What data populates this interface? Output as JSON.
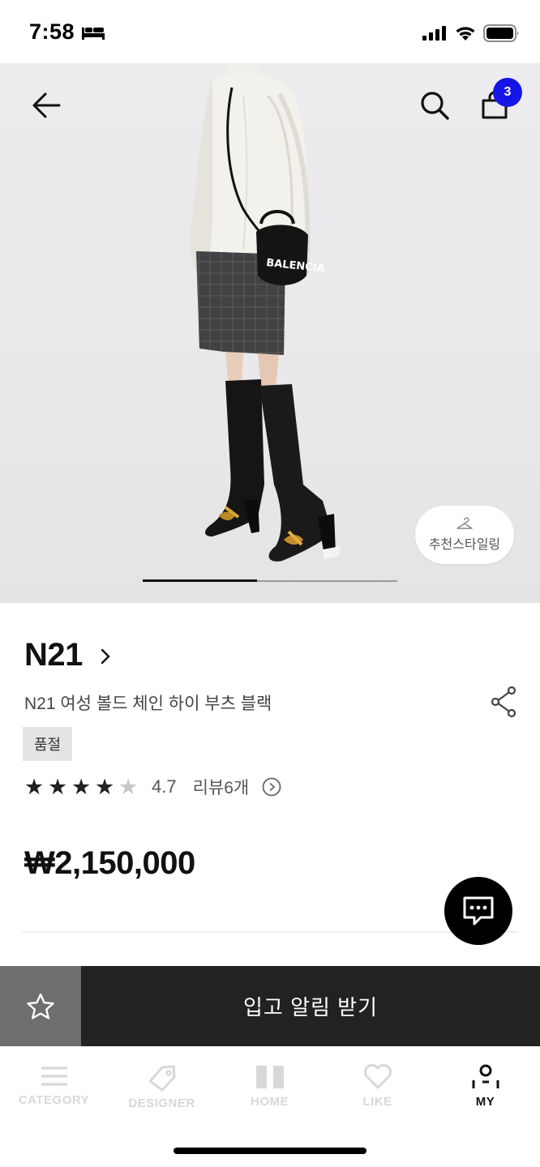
{
  "status_bar": {
    "time": "7:58"
  },
  "header": {
    "cart_count": "3"
  },
  "hero": {
    "bag_print": "BALENCIA",
    "style_button_label": "추천스타일링",
    "carousel_progress_fraction": 0.45
  },
  "product": {
    "brand": "N21",
    "name": "N21 여성 볼드 체인 하이 부츠 블랙",
    "status_badge": "품절",
    "rating_value": 4.7,
    "rating_text": "4.7",
    "reviews_label": "리뷰6개",
    "price": "₩2,150,000"
  },
  "actions": {
    "notify_label": "입고 알림 받기"
  },
  "tabbar": {
    "items": [
      {
        "label": "CATEGORY",
        "icon": "menu-icon"
      },
      {
        "label": "DESIGNER",
        "icon": "tag-icon"
      },
      {
        "label": "HOME",
        "icon": "home-icon"
      },
      {
        "label": "LIKE",
        "icon": "heart-icon"
      },
      {
        "label": "MY",
        "icon": "person-icon",
        "active": true
      }
    ]
  },
  "colors": {
    "badge_blue": "#1515e6",
    "button_dark": "#222222",
    "fav_gray": "#6e6e6e"
  }
}
